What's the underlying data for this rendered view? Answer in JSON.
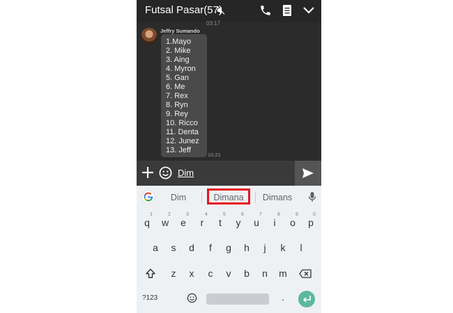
{
  "header": {
    "title": "Futsal Pasar(57)",
    "icons": [
      "mute-icon",
      "phone-icon",
      "notes-icon",
      "chevron-down-icon"
    ]
  },
  "chat": {
    "previous_time": "03:17",
    "sender": "Jeffry Sumando",
    "lines": [
      "1.Mayo",
      "2. Mike",
      "3. Aing",
      "4. Myron",
      "5. Gan",
      "6. Me",
      "7. Rex",
      "8. Ryn",
      "9. Rey",
      "10. Ricco",
      "11. Denta",
      "12. Junez",
      "13. Jeff"
    ],
    "time": "10:21"
  },
  "input": {
    "text": "Dim",
    "icons": [
      "plus-icon",
      "emoji-icon",
      "send-icon"
    ]
  },
  "keyboard": {
    "suggestions": [
      "Dim",
      "Dimana",
      "Dimans"
    ],
    "highlighted_suggestion": "Dimana",
    "highlight_color": "#e6141c",
    "row1": [
      "q",
      "w",
      "e",
      "r",
      "t",
      "y",
      "u",
      "i",
      "o",
      "p"
    ],
    "row1_hints": [
      "1",
      "2",
      "3",
      "4",
      "5",
      "6",
      "7",
      "8",
      "9",
      "0"
    ],
    "row2": [
      "a",
      "s",
      "d",
      "f",
      "g",
      "h",
      "j",
      "k",
      "l"
    ],
    "row3": [
      "z",
      "x",
      "c",
      "v",
      "b",
      "n",
      "m"
    ],
    "symbols_label": "?123",
    "period": ".",
    "enter_color": "#5cb89e"
  }
}
